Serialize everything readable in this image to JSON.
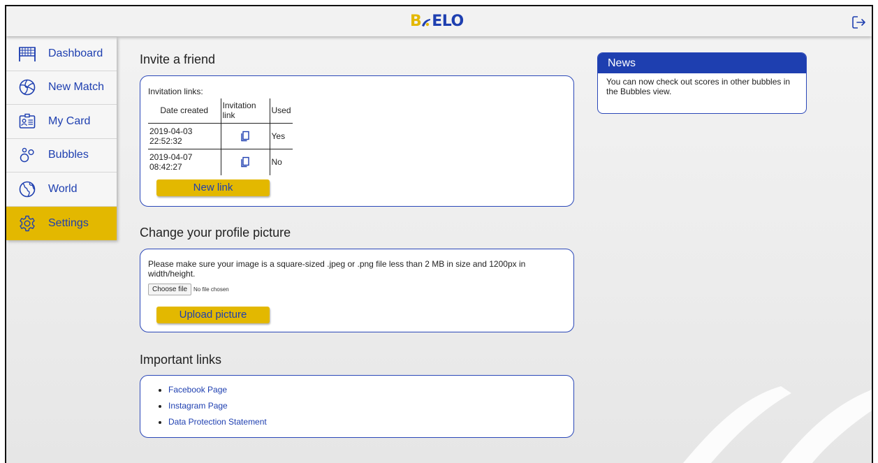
{
  "header": {
    "logo_prefix": "B",
    "logo_text": "ELO",
    "logout_icon": "logout-icon"
  },
  "colors": {
    "brand_blue": "#1e3fb0",
    "brand_yellow": "#e3b800"
  },
  "sidebar": {
    "items": [
      {
        "label": "Dashboard",
        "icon": "net-icon",
        "active": false
      },
      {
        "label": "New Match",
        "icon": "volleyball-icon",
        "active": false
      },
      {
        "label": "My Card",
        "icon": "id-card-icon",
        "active": false
      },
      {
        "label": "Bubbles",
        "icon": "bubbles-icon",
        "active": false
      },
      {
        "label": "World",
        "icon": "globe-icon",
        "active": false
      },
      {
        "label": "Settings",
        "icon": "gear-icon",
        "active": true
      }
    ]
  },
  "invite": {
    "title": "Invite a friend",
    "links_label": "Invitation links:",
    "columns": [
      "Date created",
      "Invitation link",
      "Used"
    ],
    "rows": [
      {
        "date": "2019-04-03 22:52:32",
        "used": "Yes"
      },
      {
        "date": "2019-04-07 08:42:27",
        "used": "No"
      }
    ],
    "new_link_button": "New link"
  },
  "profile_picture": {
    "title": "Change your profile picture",
    "instructions": "Please make sure your image is a square-sized .jpeg or .png file less than 2 MB in size and 1200px in width/height.",
    "choose_file_button": "Choose file",
    "file_status": "No file chosen",
    "upload_button": "Upload picture"
  },
  "important_links": {
    "title": "Important links",
    "items": [
      "Facebook Page",
      "Instagram Page",
      "Data Protection Statement"
    ]
  },
  "news": {
    "title": "News",
    "body": "You can now check out scores in other bubbles in the Bubbles view."
  }
}
